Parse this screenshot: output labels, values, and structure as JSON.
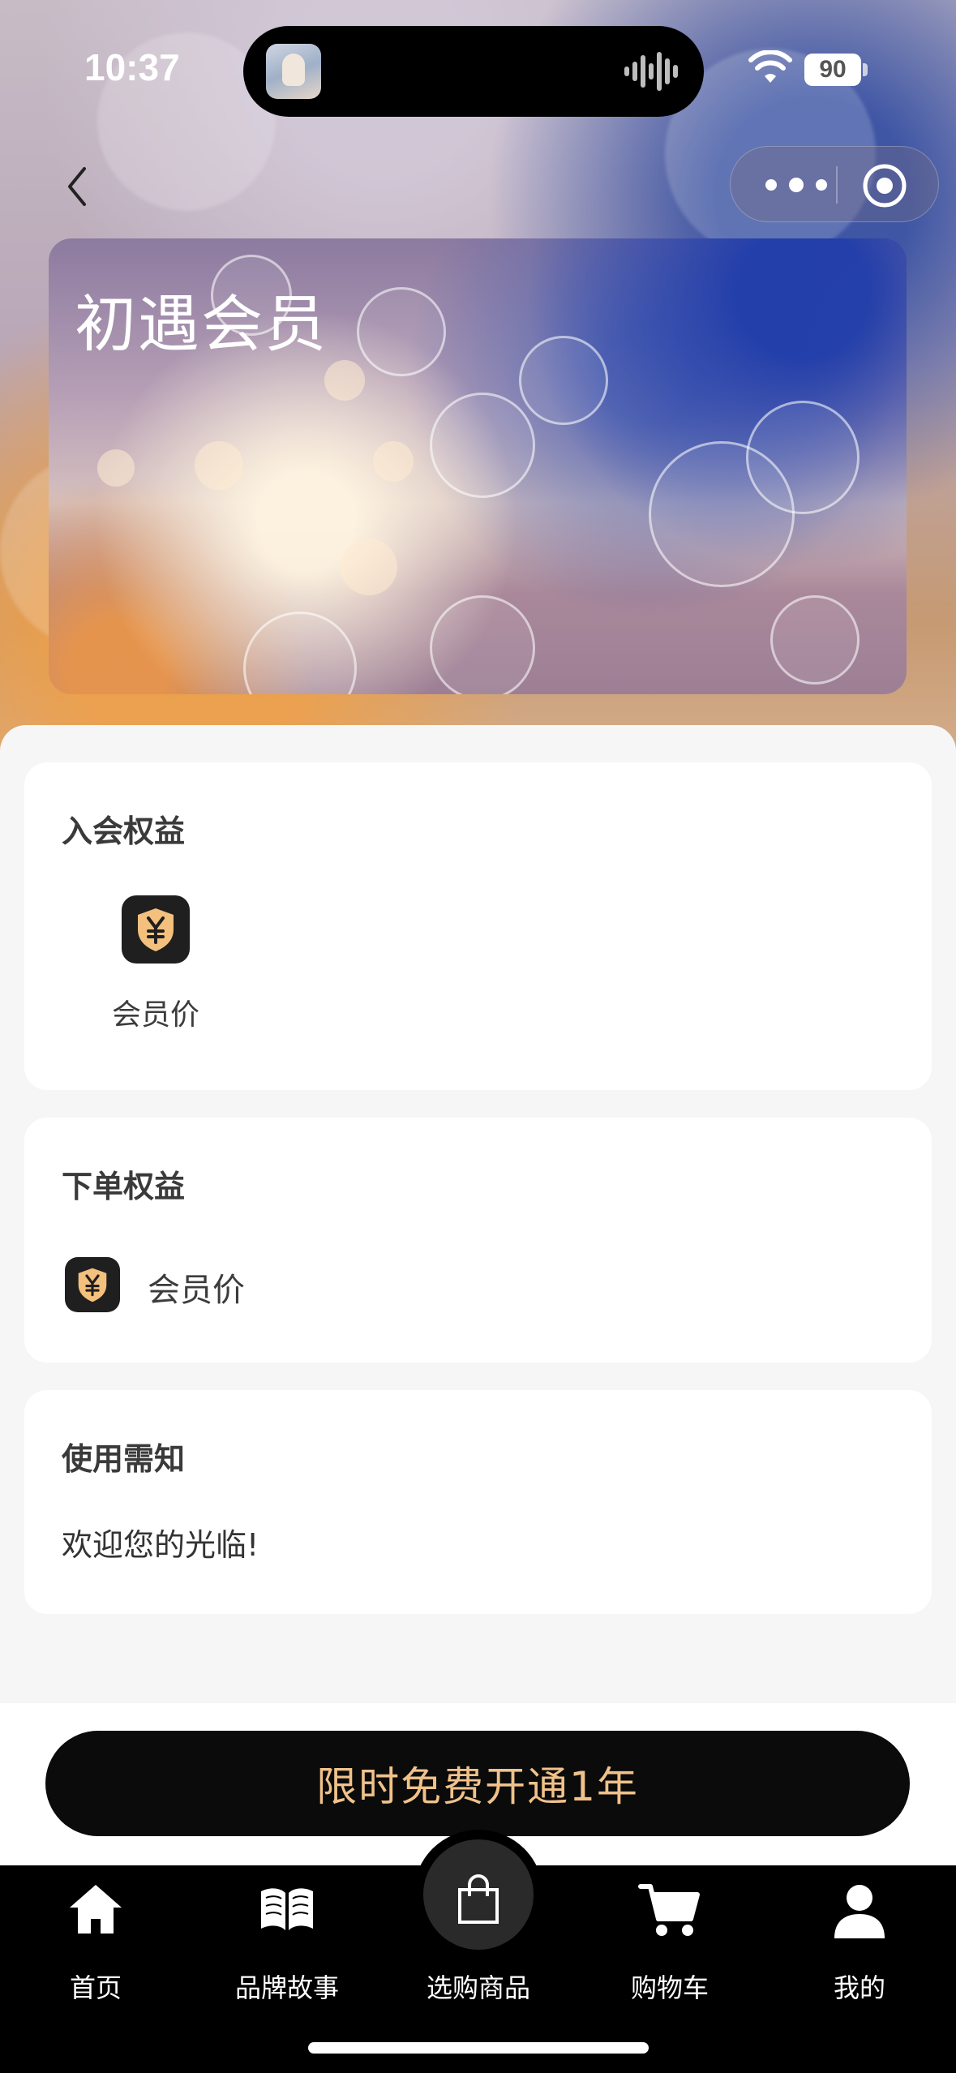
{
  "status_bar": {
    "time": "10:37",
    "battery": "90",
    "icons": [
      "avatar-icon",
      "waveform-icon",
      "wifi-icon",
      "battery-icon"
    ]
  },
  "nav": {
    "icons": [
      "back-chevron-icon",
      "more-dots-icon",
      "target-circle-icon"
    ]
  },
  "card": {
    "title": "初遇会员"
  },
  "join_benefits": {
    "title": "入会权益",
    "items": [
      {
        "label": "会员价",
        "icon": "yuan-shield-icon"
      }
    ]
  },
  "order_benefits": {
    "title": "下单权益",
    "items": [
      {
        "label": "会员价",
        "icon": "yuan-shield-icon"
      }
    ]
  },
  "notice": {
    "title": "使用需知",
    "text": "欢迎您的光临!"
  },
  "cta": {
    "label": "限时免费开通1年",
    "color": "#f0c28a"
  },
  "tabbar": {
    "items": [
      {
        "label": "首页",
        "icon": "home-icon"
      },
      {
        "label": "品牌故事",
        "icon": "book-icon"
      },
      {
        "label": "选购商品",
        "icon": "shopping-bag-icon"
      },
      {
        "label": "购物车",
        "icon": "cart-icon"
      },
      {
        "label": "我的",
        "icon": "person-icon"
      }
    ]
  }
}
